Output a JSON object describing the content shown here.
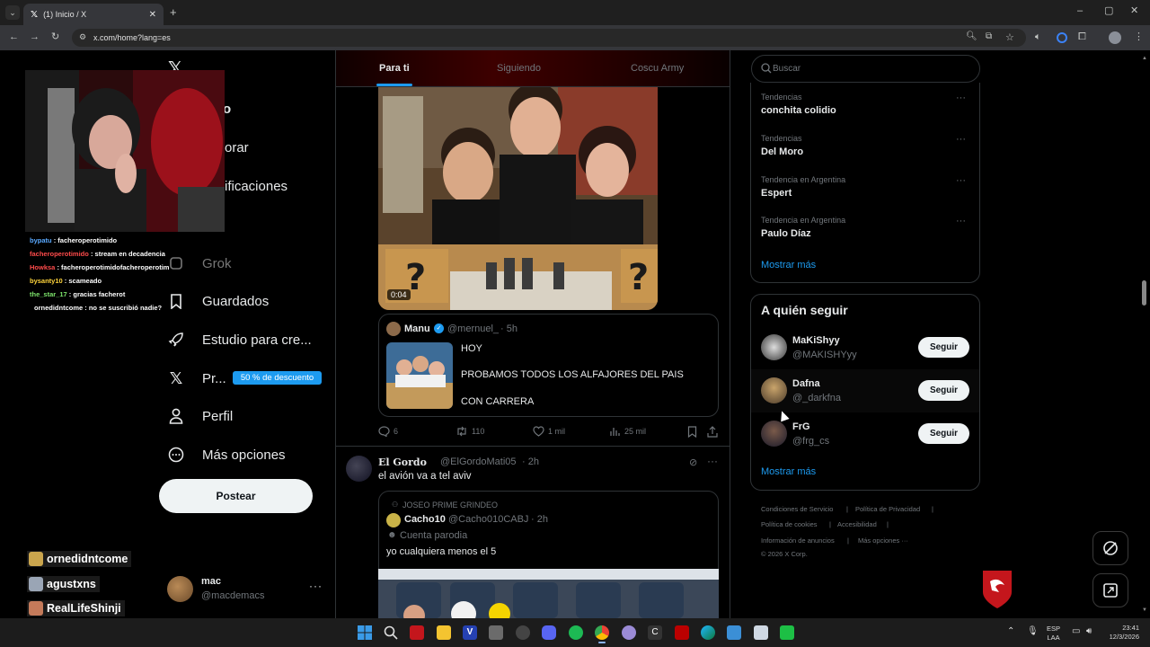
{
  "browser": {
    "tab_title": "(1) Inicio / X",
    "url": "x.com/home?lang=es"
  },
  "sidebar": {
    "items": [
      {
        "label": "Inicio",
        "visible": "o"
      },
      {
        "label": "Explorar",
        "visible": "orar"
      },
      {
        "label": "Notificaciones",
        "visible": "ificaciones"
      },
      {
        "label": "Grok",
        "visible": "Grok"
      },
      {
        "label": "Guardados",
        "visible": "Guardados"
      },
      {
        "label": "Estudio para cre...",
        "visible": "Estudio para cre..."
      },
      {
        "label": "Pr...",
        "visible": "Pr..."
      },
      {
        "label": "Perfil",
        "visible": "Perfil"
      },
      {
        "label": "Más opciones",
        "visible": "Más opciones"
      }
    ],
    "premium_badge": "50 % de descuento",
    "post_button": "Postear",
    "account": {
      "name": "mac",
      "handle": "@macdemacs"
    }
  },
  "feed": {
    "tabs": [
      "Para ti",
      "Siguiendo",
      "Coscu Army"
    ],
    "video_duration": "0:04",
    "quote1": {
      "name": "Manu",
      "handle": "@mernuel_",
      "time": "· 5h",
      "lines": [
        "HOY",
        "PROBAMOS TODOS LOS ALFAJORES DEL PAIS",
        "CON CARRERA"
      ]
    },
    "metrics": {
      "replies": "6",
      "reposts": "110",
      "likes": "1 mil",
      "views": "25 mil"
    },
    "post2": {
      "name": "El Gordo",
      "handle": "@ElGordoMati05",
      "time": "· 2h",
      "text": "el avión va a tel aviv",
      "quote": {
        "community": "JOSEO PRIME GRINDEO",
        "name": "Cacho10",
        "handle": "@Cacho010CABJ",
        "time": "· 2h",
        "label": "Cuenta parodia",
        "text": "yo cualquiera menos el 5"
      }
    }
  },
  "right": {
    "search_placeholder": "Buscar",
    "trends": [
      {
        "category": "Tendencias",
        "name": "conchita colidio"
      },
      {
        "category": "Tendencias",
        "name": "Del Moro"
      },
      {
        "category": "Tendencia en Argentina",
        "name": "Espert"
      },
      {
        "category": "Tendencia en Argentina",
        "name": "Paulo Díaz"
      }
    ],
    "show_more": "Mostrar más",
    "who_to_follow_title": "A quién seguir",
    "follow": [
      {
        "name": "MaKiShyy",
        "handle": "@MAKISHYyy",
        "button": "Seguir"
      },
      {
        "name": "Dafna",
        "handle": "@_darkfna",
        "button": "Seguir"
      },
      {
        "name": "FrG",
        "handle": "@frg_cs",
        "button": "Seguir"
      }
    ],
    "show_more2": "Mostrar más",
    "footer": {
      "terms": "Condiciones de Servicio",
      "privacy": "Política de Privacidad",
      "cookies": "Política de cookies",
      "access": "Accesibilidad",
      "ads": "Información de anuncios",
      "more": "Más opciones ···",
      "copy": "© 2026 X Corp."
    }
  },
  "stream_chat": [
    {
      "user": "bypatu",
      "msg": ": facheroperotimido",
      "color": "#5aa9ff"
    },
    {
      "user": "facheroperotimido",
      "msg": ": stream en decadencia",
      "color": "#ff4b4b"
    },
    {
      "user": "Howksa",
      "msg": ": facheroperotimidofacheroperotim",
      "color": "#ff4b4b"
    },
    {
      "user": "bysanty10",
      "msg": ": scameado",
      "color": "#ffd43b"
    },
    {
      "user": "the_star_17",
      "msg": ": gracias facherot",
      "color": "#7ce36b"
    },
    {
      "user": "ornedidntcome",
      "msg": ": no se suscribió nadie?",
      "color": "#ffffff"
    }
  ],
  "stream_subs": [
    "ornedidntcome",
    "agustxns",
    "RealLifeShinji"
  ],
  "taskbar": {
    "lang": "ESP",
    "lang2": "LAA",
    "time": "23:41",
    "date": "12/3/2026"
  },
  "colors": {
    "accent": "#1d9bf0",
    "background": "#000000",
    "border": "#2f3336"
  }
}
